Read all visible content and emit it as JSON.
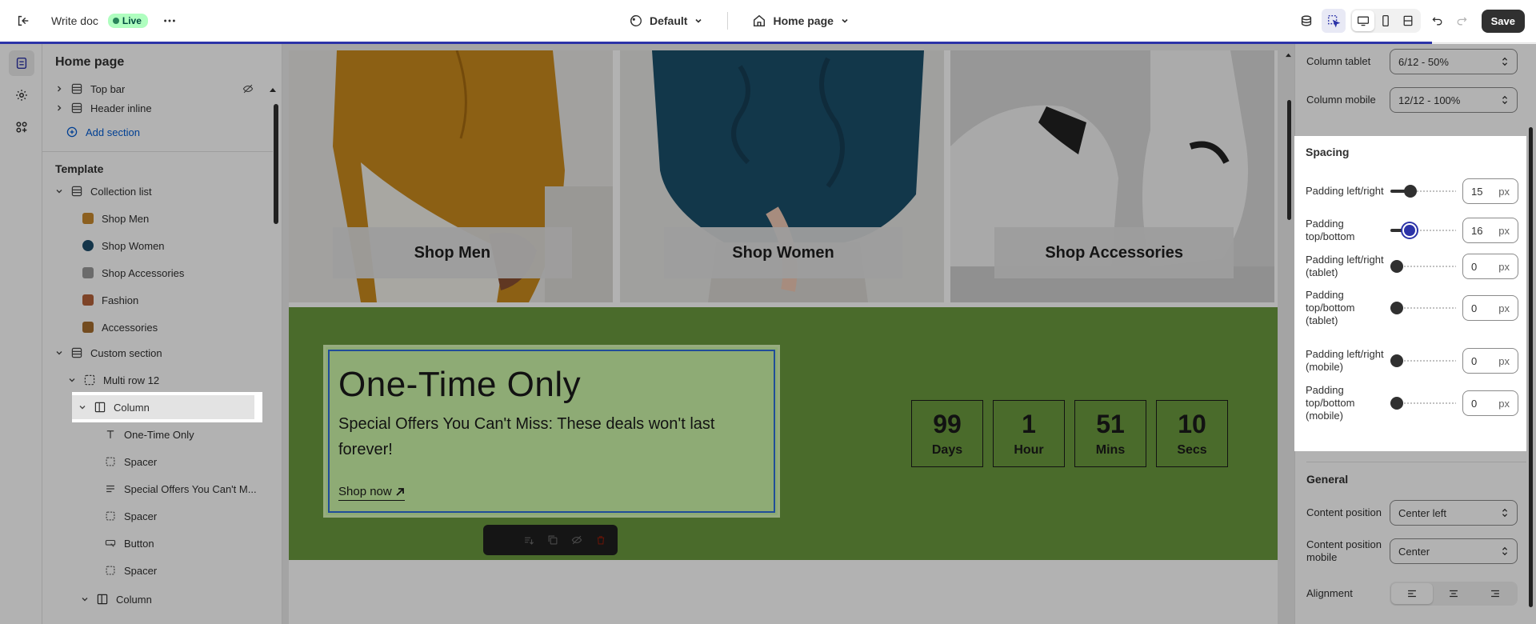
{
  "topbar": {
    "doc_title": "Write doc",
    "live_label": "Live",
    "theme_label": "Default",
    "page_label": "Home page",
    "save_label": "Save"
  },
  "sidebar": {
    "title": "Home page",
    "header_group": [
      {
        "label": "Top bar"
      },
      {
        "label": "Header inline"
      }
    ],
    "add_section": "Add section",
    "template_title": "Template",
    "collection_list": "Collection list",
    "collection_items": [
      {
        "label": "Shop Men"
      },
      {
        "label": "Shop Women"
      },
      {
        "label": "Shop Accessories"
      },
      {
        "label": "Fashion"
      },
      {
        "label": "Accessories"
      }
    ],
    "custom_section": "Custom section",
    "multi_row": "Multi row 12",
    "column": "Column",
    "column_children": [
      {
        "label": "One-Time Only",
        "icon": "text-icon"
      },
      {
        "label": "Spacer",
        "icon": "spacer-icon"
      },
      {
        "label": "Special Offers You Can't M...",
        "icon": "paragraph-icon"
      },
      {
        "label": "Spacer",
        "icon": "spacer-icon"
      },
      {
        "label": "Button",
        "icon": "button-icon"
      },
      {
        "label": "Spacer",
        "icon": "spacer-icon"
      }
    ],
    "column2": "Column"
  },
  "canvas": {
    "cards": [
      {
        "label": "Shop Men"
      },
      {
        "label": "Shop Women"
      },
      {
        "label": "Shop Accessories"
      }
    ],
    "promo": {
      "title": "One-Time Only",
      "description": "Special Offers You Can't Miss: These deals won't last forever!",
      "link": "Shop now"
    },
    "countdown": [
      {
        "value": "99",
        "unit": "Days"
      },
      {
        "value": "1",
        "unit": "Hour"
      },
      {
        "value": "51",
        "unit": "Mins"
      },
      {
        "value": "10",
        "unit": "Secs"
      }
    ]
  },
  "panel": {
    "column_tablet_label": "Column tablet",
    "column_tablet_value": "6/12 - 50%",
    "column_mobile_label": "Column mobile",
    "column_mobile_value": "12/12 - 100%",
    "spacing_title": "Spacing",
    "spacing": [
      {
        "label": "Padding left/right",
        "value": "15",
        "unit": "px",
        "level": 0.25,
        "active": false
      },
      {
        "label": "Padding top/bottom",
        "value": "16",
        "unit": "px",
        "level": 0.26,
        "active": true
      },
      {
        "label": "Padding left/right (tablet)",
        "value": "0",
        "unit": "px",
        "level": 0,
        "active": false
      },
      {
        "label": "Padding top/bottom (tablet)",
        "value": "0",
        "unit": "px",
        "level": 0,
        "active": false
      },
      {
        "label": "Padding left/right (mobile)",
        "value": "0",
        "unit": "px",
        "level": 0,
        "active": false
      },
      {
        "label": "Padding top/bottom (mobile)",
        "value": "0",
        "unit": "px",
        "level": 0,
        "active": false
      }
    ],
    "general_title": "General",
    "content_position_label": "Content position",
    "content_position_value": "Center left",
    "content_position_mobile_label": "Content position mobile",
    "content_position_mobile_value": "Center",
    "alignment_label": "Alignment"
  },
  "colors": {
    "accent": "#2c33a8",
    "promo_bg": "#6b9a3e",
    "promo_box": "#ccf5a8",
    "live_badge": "#affebf"
  }
}
